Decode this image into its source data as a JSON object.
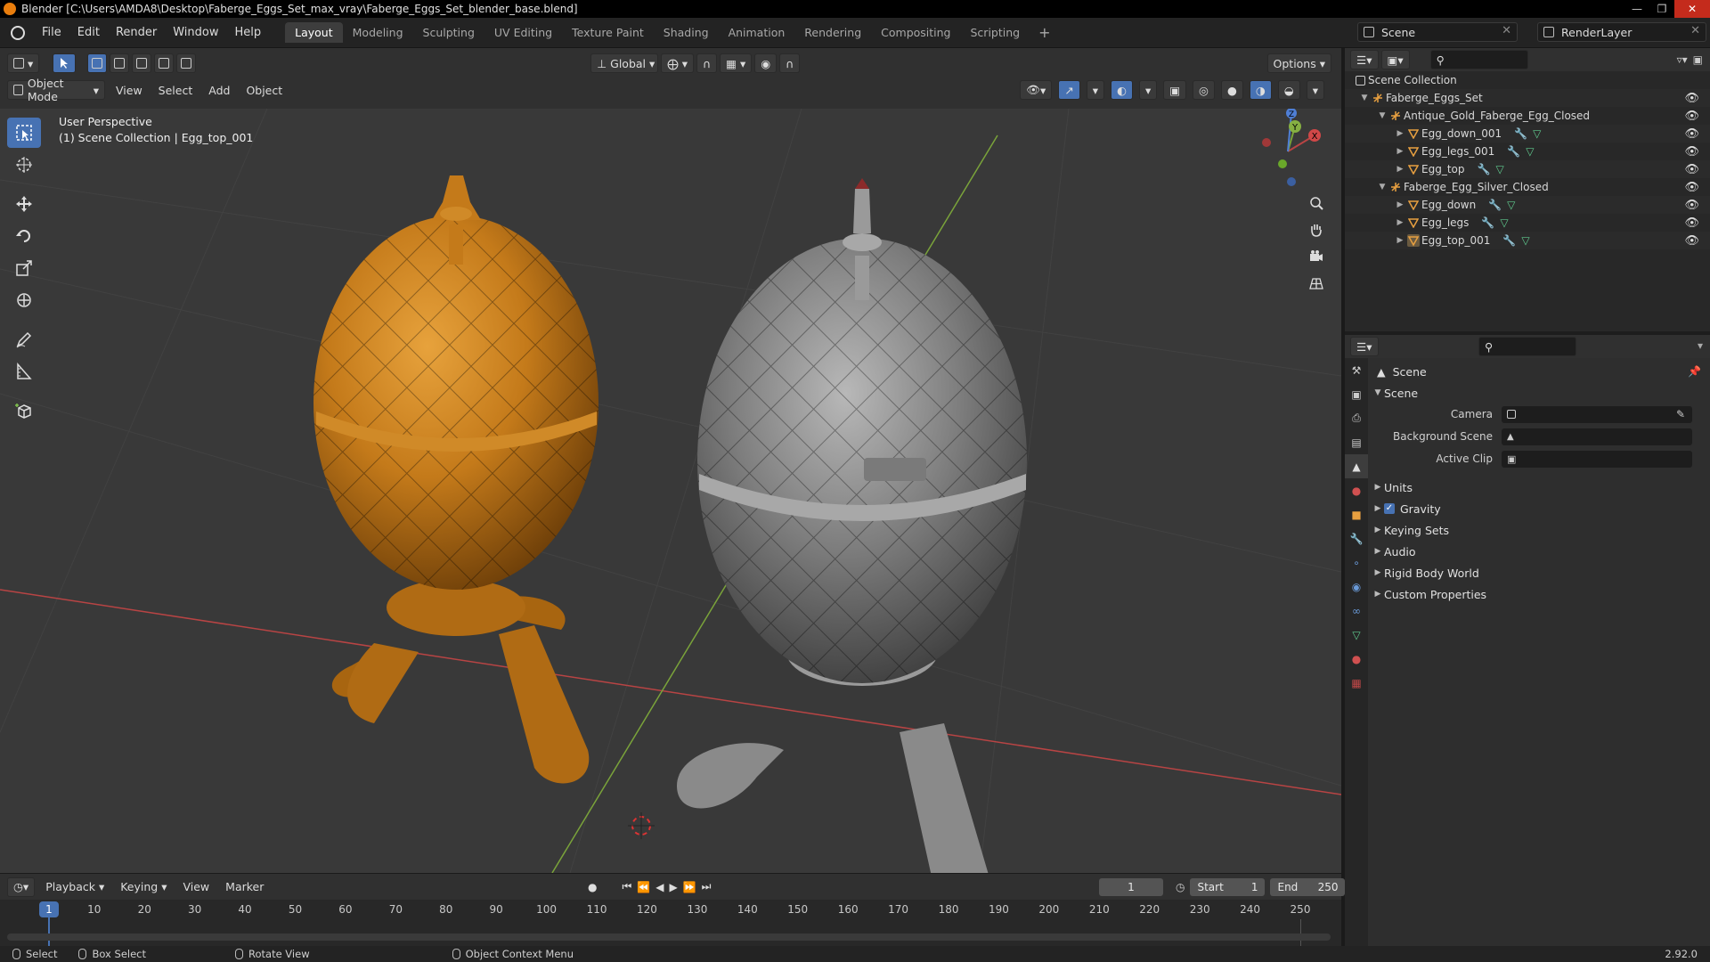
{
  "window": {
    "title": "Blender [C:\\Users\\AMDA8\\Desktop\\Faberge_Eggs_Set_max_vray\\Faberge_Eggs_Set_blender_base.blend]"
  },
  "menus": [
    "File",
    "Edit",
    "Render",
    "Window",
    "Help"
  ],
  "workspaces": {
    "tabs": [
      "Layout",
      "Modeling",
      "Sculpting",
      "UV Editing",
      "Texture Paint",
      "Shading",
      "Animation",
      "Rendering",
      "Compositing",
      "Scripting"
    ],
    "active": "Layout"
  },
  "top_right": {
    "scene": "Scene",
    "view_layer": "RenderLayer"
  },
  "viewport_header": {
    "mode": "Object Mode",
    "menus": [
      "View",
      "Select",
      "Add",
      "Object"
    ],
    "transform_orientation": "Global",
    "options": "Options"
  },
  "viewport": {
    "view_name": "User Perspective",
    "collection_info": "(1) Scene Collection | Egg_top_001",
    "gizmo_labels": {
      "x": "X",
      "y": "Y",
      "z": "Z"
    }
  },
  "outliner": {
    "rows": [
      {
        "name": "Scene Collection",
        "type": "scene-collection-icon"
      },
      {
        "name": "Faberge_Eggs_Set",
        "type": "empty-icon"
      },
      {
        "name": "Antique_Gold_Faberge_Egg_Closed",
        "type": "empty-icon"
      },
      {
        "name": "Egg_down_001",
        "type": "mesh-icon"
      },
      {
        "name": "Egg_legs_001",
        "type": "mesh-icon"
      },
      {
        "name": "Egg_top",
        "type": "mesh-icon"
      },
      {
        "name": "Faberge_Egg_Silver_Closed",
        "type": "empty-icon"
      },
      {
        "name": "Egg_down",
        "type": "mesh-icon"
      },
      {
        "name": "Egg_legs",
        "type": "mesh-icon"
      },
      {
        "name": "Egg_top_001",
        "type": "mesh-icon"
      }
    ]
  },
  "properties": {
    "context": "Scene",
    "panel": "Scene",
    "fields": {
      "camera": "Camera",
      "background_scene": "Background Scene",
      "active_clip": "Active Clip"
    },
    "subpanels": [
      "Units",
      "Gravity",
      "Keying Sets",
      "Audio",
      "Rigid Body World",
      "Custom Properties"
    ]
  },
  "timeline": {
    "menus": [
      "Playback",
      "Keying",
      "View",
      "Marker"
    ],
    "current_frame": "1",
    "start_label": "Start",
    "start": "1",
    "end_label": "End",
    "end": "250",
    "ruler": [
      "1",
      "10",
      "20",
      "30",
      "40",
      "50",
      "60",
      "70",
      "80",
      "90",
      "100",
      "110",
      "120",
      "130",
      "140",
      "150",
      "160",
      "170",
      "180",
      "190",
      "200",
      "210",
      "220",
      "230",
      "240",
      "250"
    ]
  },
  "statusbar": {
    "select": "Select",
    "box_select": "Box Select",
    "rotate_view": "Rotate View",
    "context_menu": "Object Context Menu",
    "version": "2.92.0"
  },
  "colors": {
    "accent": "#4772b3",
    "gold_egg": "#c47a1a",
    "silver_egg": "#8e8e8e",
    "x_axis": "#b84444",
    "y_axis": "#7aa33a",
    "z_axis": "#4f7fd6"
  }
}
